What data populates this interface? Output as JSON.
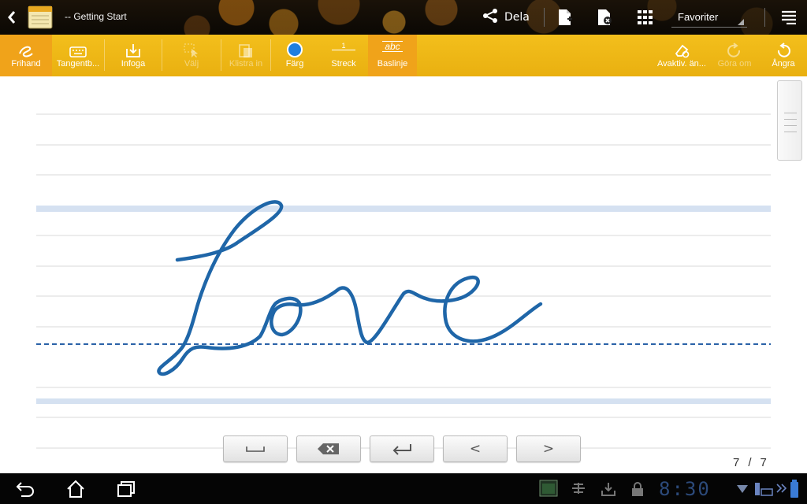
{
  "topbar": {
    "title": "-- Getting Start",
    "share_label": "Dela",
    "favorites_label": "Favoriter",
    "icons": [
      "chevron-left-icon",
      "notebook-app-icon",
      "share-icon",
      "new-page-icon",
      "delete-page-icon",
      "grid-icon",
      "menu-icon"
    ]
  },
  "toolbar": {
    "items": [
      {
        "label": "Frihand",
        "icon": "freehand-icon",
        "state": "active"
      },
      {
        "label": "Tangentb...",
        "icon": "keyboard-icon",
        "state": "normal"
      },
      {
        "label": "Infoga",
        "icon": "insert-icon",
        "state": "normal"
      },
      {
        "label": "Välj",
        "icon": "select-icon",
        "state": "disabled"
      },
      {
        "label": "Klistra in",
        "icon": "paste-icon",
        "state": "disabled"
      },
      {
        "label": "Färg",
        "icon": "color-dot-icon",
        "state": "normal"
      },
      {
        "label": "Streck",
        "icon": "stroke-width-icon",
        "state": "normal",
        "value": "1"
      },
      {
        "label": "Baslinje",
        "icon": "baseline-icon",
        "state": "active",
        "sample": "abc"
      },
      {
        "label": "Avaktiv. än...",
        "icon": "eraser-icon",
        "state": "normal"
      },
      {
        "label": "Göra om",
        "icon": "redo-icon",
        "state": "disabled"
      },
      {
        "label": "Ångra",
        "icon": "undo-icon",
        "state": "normal"
      }
    ],
    "colors": {
      "bar": "#f0b915",
      "active": "#f0a31a",
      "pen": "#1f66a8"
    }
  },
  "page": {
    "current": "7",
    "separator": "/",
    "total": "7",
    "handwriting": "Love",
    "handwriting_color": "#1f66a8"
  },
  "keys": [
    {
      "name": "space-key",
      "icon": "space-icon"
    },
    {
      "name": "backspace-key",
      "icon": "backspace-icon"
    },
    {
      "name": "enter-key",
      "icon": "enter-icon"
    },
    {
      "name": "prev-key",
      "icon": "chevron-left-icon",
      "glyph": "<"
    },
    {
      "name": "next-key",
      "icon": "chevron-right-icon",
      "glyph": ">"
    }
  ],
  "statusbar": {
    "time": "8:30",
    "icons": [
      "back-icon",
      "home-icon",
      "recent-apps-icon",
      "screenshot-icon",
      "debug-icon",
      "download-icon",
      "lock-icon",
      "wifi-icon",
      "dock-keyboard-icon",
      "battery-icon"
    ]
  }
}
